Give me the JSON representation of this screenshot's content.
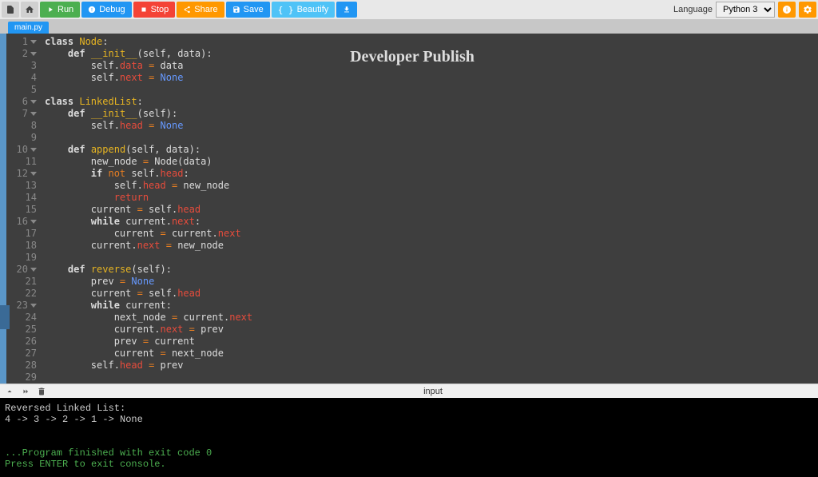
{
  "toolbar": {
    "run": "Run",
    "debug": "Debug",
    "stop": "Stop",
    "share": "Share",
    "save": "Save",
    "beautify": "Beautify",
    "language_label": "Language",
    "language_selected": "Python 3"
  },
  "tabs": {
    "active": "main.py"
  },
  "watermark": "Developer Publish",
  "code": {
    "lines": [
      {
        "n": 1,
        "fold": true,
        "html": "<span class='kw'>class</span> <span class='fn'>Node</span>:"
      },
      {
        "n": 2,
        "fold": true,
        "html": "    <span class='kw'>def</span> <span class='fn'>__init__</span>(self, data):"
      },
      {
        "n": 3,
        "fold": false,
        "html": "        self.<span class='attr'>data</span> <span class='op'>=</span> data"
      },
      {
        "n": 4,
        "fold": false,
        "html": "        self.<span class='attr'>next</span> <span class='op'>=</span> <span class='none'>None</span>"
      },
      {
        "n": 5,
        "fold": false,
        "html": ""
      },
      {
        "n": 6,
        "fold": true,
        "html": "<span class='kw'>class</span> <span class='fn'>LinkedList</span>:"
      },
      {
        "n": 7,
        "fold": true,
        "html": "    <span class='kw'>def</span> <span class='fn'>__init__</span>(self):"
      },
      {
        "n": 8,
        "fold": false,
        "html": "        self.<span class='attr'>head</span> <span class='op'>=</span> <span class='none'>None</span>"
      },
      {
        "n": 9,
        "fold": false,
        "html": ""
      },
      {
        "n": 10,
        "fold": true,
        "html": "    <span class='kw'>def</span> <span class='fn'>append</span>(self, data):"
      },
      {
        "n": 11,
        "fold": false,
        "html": "        new_node <span class='op'>=</span> Node(data)"
      },
      {
        "n": 12,
        "fold": true,
        "html": "        <span class='kw'>if</span> <span class='op'>not</span> self.<span class='attr'>head</span>:"
      },
      {
        "n": 13,
        "fold": false,
        "html": "            self.<span class='attr'>head</span> <span class='op'>=</span> new_node"
      },
      {
        "n": 14,
        "fold": false,
        "html": "            <span class='attr'>return</span>"
      },
      {
        "n": 15,
        "fold": false,
        "html": "        current <span class='op'>=</span> self.<span class='attr'>head</span>"
      },
      {
        "n": 16,
        "fold": true,
        "html": "        <span class='kw'>while</span> current.<span class='attr'>next</span>:"
      },
      {
        "n": 17,
        "fold": false,
        "html": "            current <span class='op'>=</span> current.<span class='attr'>next</span>"
      },
      {
        "n": 18,
        "fold": false,
        "html": "        current.<span class='attr'>next</span> <span class='op'>=</span> new_node"
      },
      {
        "n": 19,
        "fold": false,
        "html": ""
      },
      {
        "n": 20,
        "fold": true,
        "html": "    <span class='kw'>def</span> <span class='fn'>reverse</span>(self):"
      },
      {
        "n": 21,
        "fold": false,
        "html": "        prev <span class='op'>=</span> <span class='none'>None</span>"
      },
      {
        "n": 22,
        "fold": false,
        "html": "        current <span class='op'>=</span> self.<span class='attr'>head</span>"
      },
      {
        "n": 23,
        "fold": true,
        "html": "        <span class='kw'>while</span> current:"
      },
      {
        "n": 24,
        "fold": false,
        "html": "            next_node <span class='op'>=</span> current.<span class='attr'>next</span>"
      },
      {
        "n": 25,
        "fold": false,
        "html": "            current.<span class='attr'>next</span> <span class='op'>=</span> prev"
      },
      {
        "n": 26,
        "fold": false,
        "html": "            prev <span class='op'>=</span> current"
      },
      {
        "n": 27,
        "fold": false,
        "html": "            current <span class='op'>=</span> next_node"
      },
      {
        "n": 28,
        "fold": false,
        "html": "        self.<span class='attr'>head</span> <span class='op'>=</span> prev"
      },
      {
        "n": 29,
        "fold": false,
        "html": ""
      }
    ]
  },
  "console": {
    "input_label": "input",
    "output": [
      {
        "text": "Reversed Linked List:",
        "green": false
      },
      {
        "text": "4 -> 3 -> 2 -> 1 -> None",
        "green": false
      },
      {
        "text": "",
        "green": false
      },
      {
        "text": "",
        "green": false
      },
      {
        "text": "...Program finished with exit code 0",
        "green": true
      },
      {
        "text": "Press ENTER to exit console.",
        "green": true
      }
    ]
  }
}
